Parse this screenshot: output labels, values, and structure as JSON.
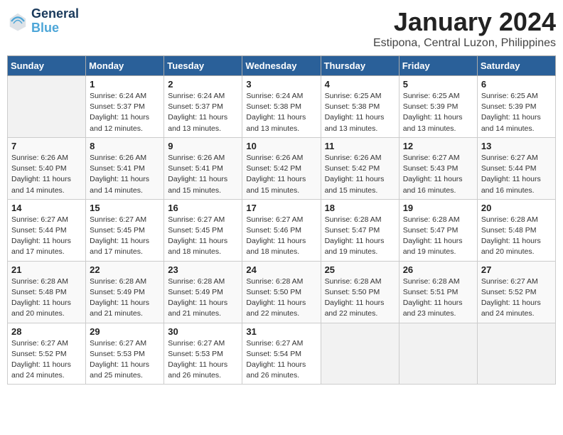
{
  "logo": {
    "line1": "General",
    "line2": "Blue"
  },
  "title": "January 2024",
  "subtitle": "Estipona, Central Luzon, Philippines",
  "days_of_week": [
    "Sunday",
    "Monday",
    "Tuesday",
    "Wednesday",
    "Thursday",
    "Friday",
    "Saturday"
  ],
  "weeks": [
    [
      {
        "day": "",
        "info": ""
      },
      {
        "day": "1",
        "info": "Sunrise: 6:24 AM\nSunset: 5:37 PM\nDaylight: 11 hours\nand 12 minutes."
      },
      {
        "day": "2",
        "info": "Sunrise: 6:24 AM\nSunset: 5:37 PM\nDaylight: 11 hours\nand 13 minutes."
      },
      {
        "day": "3",
        "info": "Sunrise: 6:24 AM\nSunset: 5:38 PM\nDaylight: 11 hours\nand 13 minutes."
      },
      {
        "day": "4",
        "info": "Sunrise: 6:25 AM\nSunset: 5:38 PM\nDaylight: 11 hours\nand 13 minutes."
      },
      {
        "day": "5",
        "info": "Sunrise: 6:25 AM\nSunset: 5:39 PM\nDaylight: 11 hours\nand 13 minutes."
      },
      {
        "day": "6",
        "info": "Sunrise: 6:25 AM\nSunset: 5:39 PM\nDaylight: 11 hours\nand 14 minutes."
      }
    ],
    [
      {
        "day": "7",
        "info": "Sunrise: 6:26 AM\nSunset: 5:40 PM\nDaylight: 11 hours\nand 14 minutes."
      },
      {
        "day": "8",
        "info": "Sunrise: 6:26 AM\nSunset: 5:41 PM\nDaylight: 11 hours\nand 14 minutes."
      },
      {
        "day": "9",
        "info": "Sunrise: 6:26 AM\nSunset: 5:41 PM\nDaylight: 11 hours\nand 15 minutes."
      },
      {
        "day": "10",
        "info": "Sunrise: 6:26 AM\nSunset: 5:42 PM\nDaylight: 11 hours\nand 15 minutes."
      },
      {
        "day": "11",
        "info": "Sunrise: 6:26 AM\nSunset: 5:42 PM\nDaylight: 11 hours\nand 15 minutes."
      },
      {
        "day": "12",
        "info": "Sunrise: 6:27 AM\nSunset: 5:43 PM\nDaylight: 11 hours\nand 16 minutes."
      },
      {
        "day": "13",
        "info": "Sunrise: 6:27 AM\nSunset: 5:44 PM\nDaylight: 11 hours\nand 16 minutes."
      }
    ],
    [
      {
        "day": "14",
        "info": "Sunrise: 6:27 AM\nSunset: 5:44 PM\nDaylight: 11 hours\nand 17 minutes."
      },
      {
        "day": "15",
        "info": "Sunrise: 6:27 AM\nSunset: 5:45 PM\nDaylight: 11 hours\nand 17 minutes."
      },
      {
        "day": "16",
        "info": "Sunrise: 6:27 AM\nSunset: 5:45 PM\nDaylight: 11 hours\nand 18 minutes."
      },
      {
        "day": "17",
        "info": "Sunrise: 6:27 AM\nSunset: 5:46 PM\nDaylight: 11 hours\nand 18 minutes."
      },
      {
        "day": "18",
        "info": "Sunrise: 6:28 AM\nSunset: 5:47 PM\nDaylight: 11 hours\nand 19 minutes."
      },
      {
        "day": "19",
        "info": "Sunrise: 6:28 AM\nSunset: 5:47 PM\nDaylight: 11 hours\nand 19 minutes."
      },
      {
        "day": "20",
        "info": "Sunrise: 6:28 AM\nSunset: 5:48 PM\nDaylight: 11 hours\nand 20 minutes."
      }
    ],
    [
      {
        "day": "21",
        "info": "Sunrise: 6:28 AM\nSunset: 5:48 PM\nDaylight: 11 hours\nand 20 minutes."
      },
      {
        "day": "22",
        "info": "Sunrise: 6:28 AM\nSunset: 5:49 PM\nDaylight: 11 hours\nand 21 minutes."
      },
      {
        "day": "23",
        "info": "Sunrise: 6:28 AM\nSunset: 5:49 PM\nDaylight: 11 hours\nand 21 minutes."
      },
      {
        "day": "24",
        "info": "Sunrise: 6:28 AM\nSunset: 5:50 PM\nDaylight: 11 hours\nand 22 minutes."
      },
      {
        "day": "25",
        "info": "Sunrise: 6:28 AM\nSunset: 5:50 PM\nDaylight: 11 hours\nand 22 minutes."
      },
      {
        "day": "26",
        "info": "Sunrise: 6:28 AM\nSunset: 5:51 PM\nDaylight: 11 hours\nand 23 minutes."
      },
      {
        "day": "27",
        "info": "Sunrise: 6:27 AM\nSunset: 5:52 PM\nDaylight: 11 hours\nand 24 minutes."
      }
    ],
    [
      {
        "day": "28",
        "info": "Sunrise: 6:27 AM\nSunset: 5:52 PM\nDaylight: 11 hours\nand 24 minutes."
      },
      {
        "day": "29",
        "info": "Sunrise: 6:27 AM\nSunset: 5:53 PM\nDaylight: 11 hours\nand 25 minutes."
      },
      {
        "day": "30",
        "info": "Sunrise: 6:27 AM\nSunset: 5:53 PM\nDaylight: 11 hours\nand 26 minutes."
      },
      {
        "day": "31",
        "info": "Sunrise: 6:27 AM\nSunset: 5:54 PM\nDaylight: 11 hours\nand 26 minutes."
      },
      {
        "day": "",
        "info": ""
      },
      {
        "day": "",
        "info": ""
      },
      {
        "day": "",
        "info": ""
      }
    ]
  ]
}
